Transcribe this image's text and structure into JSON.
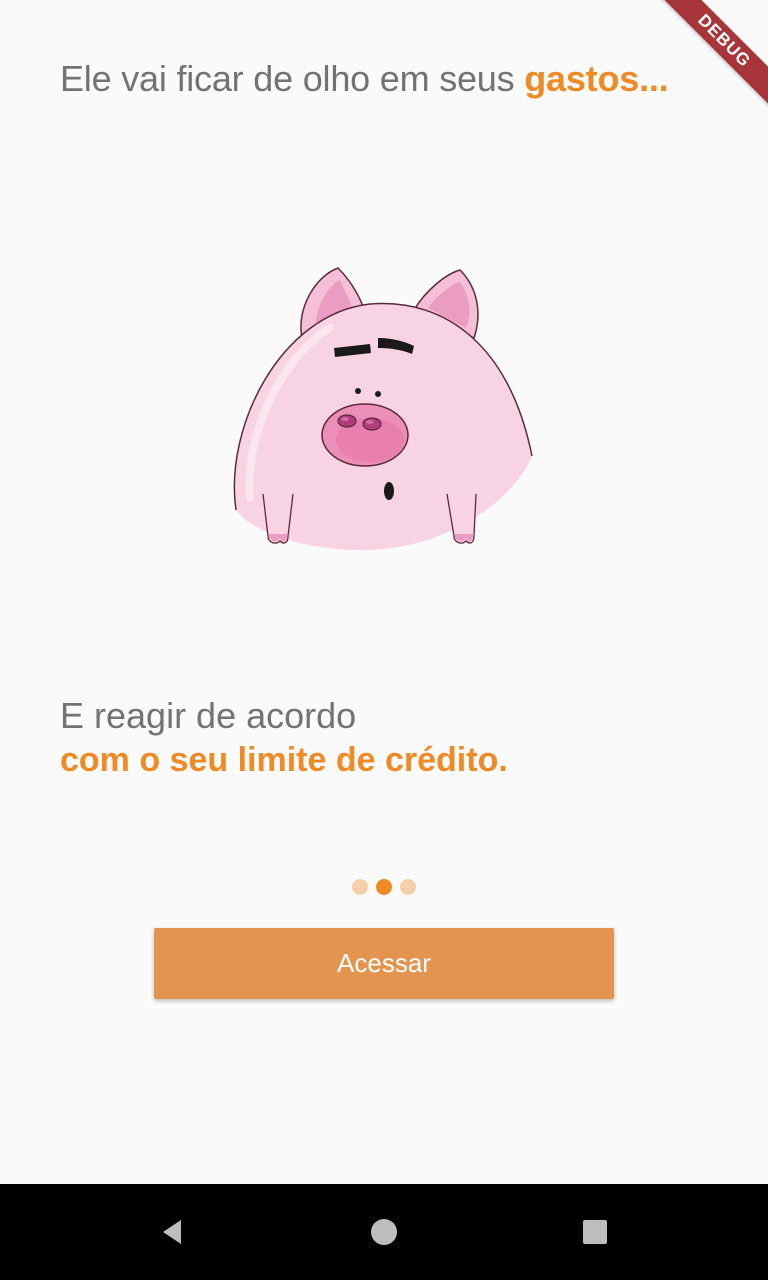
{
  "header": {
    "text_plain": "Ele vai ficar de olho em seus ",
    "text_accent": "gastos..."
  },
  "debug_banner": {
    "label": "DEBUG"
  },
  "illustration": {
    "icon": "pig-illustration"
  },
  "subtitle": {
    "line1": "E reagir de acordo",
    "line2": "com o seu limite de crédito."
  },
  "pager": {
    "count": 3,
    "active_index": 1
  },
  "actions": {
    "access_label": "Acessar"
  },
  "colors": {
    "accent": "#f08a24",
    "button": "#e3944e",
    "text_muted": "#737373",
    "dot_inactive": "#f7cfaa",
    "background": "#fafafa",
    "pig_body": "#f8d3e3",
    "pig_snout": "#eb8fb8"
  },
  "system_nav": {
    "back_icon": "back-triangle-icon",
    "home_icon": "home-circle-icon",
    "recents_icon": "recents-square-icon"
  }
}
